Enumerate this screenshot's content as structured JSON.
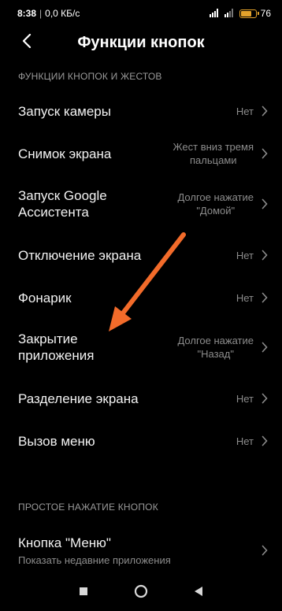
{
  "status_bar": {
    "time": "8:38",
    "network_speed": "0,0 КБ/с",
    "battery_percent": "76",
    "battery_level": 0.76
  },
  "header": {
    "title": "Функции кнопок"
  },
  "section1": {
    "title": "ФУНКЦИИ КНОПОК И ЖЕСТОВ",
    "items": [
      {
        "label": "Запуск камеры",
        "value": "Нет"
      },
      {
        "label": "Снимок экрана",
        "value_line1": "Жест вниз тремя",
        "value_line2": "пальцами"
      },
      {
        "label_line1": "Запуск Google",
        "label_line2": "Ассистента",
        "value_line1": "Долгое нажатие",
        "value_line2": "\"Домой\""
      },
      {
        "label": "Отключение экрана",
        "value": "Нет"
      },
      {
        "label": "Фонарик",
        "value": "Нет"
      },
      {
        "label_line1": "Закрытие",
        "label_line2": "приложения",
        "value_line1": "Долгое нажатие",
        "value_line2": "\"Назад\""
      },
      {
        "label": "Разделение экрана",
        "value": "Нет"
      },
      {
        "label": "Вызов меню",
        "value": "Нет"
      }
    ]
  },
  "section2": {
    "title": "ПРОСТОЕ НАЖАТИЕ КНОПОК",
    "items": [
      {
        "label": "Кнопка \"Меню\"",
        "subtext": "Показать недавние приложения"
      }
    ]
  },
  "colors": {
    "background": "#000000",
    "text": "#f2f2f2",
    "secondary_text": "#8c8c8c",
    "annotation_arrow": "#f26b2a",
    "battery": "#e3a22b"
  },
  "icons": [
    "back-arrow-icon",
    "chevron-right-icon",
    "nav-square-icon",
    "nav-circle-icon",
    "nav-triangle-icon",
    "signal-icon",
    "battery-icon"
  ]
}
